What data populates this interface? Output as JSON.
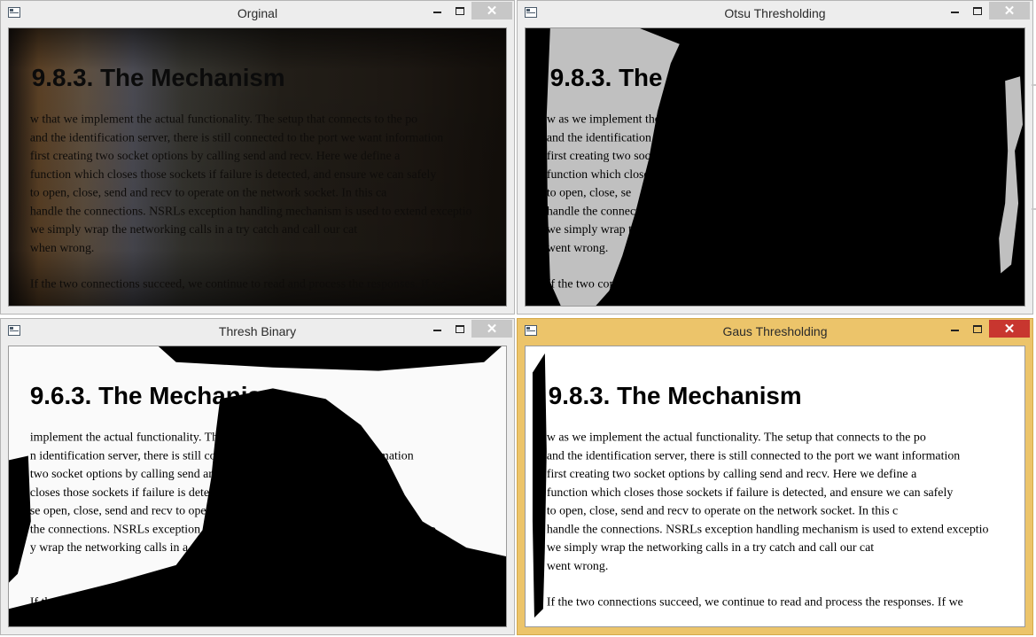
{
  "windows": [
    {
      "title": "Orginal",
      "text": {
        "heading": "9.8.3. The Mechanism",
        "lines": [
          "w that we implement the actual functionality. The setup that connects to the po",
          "and the identification server, there is still connected to the port we want information",
          "first creating two socket options by calling send and recv. Here we define a",
          "function which closes those sockets if failure is detected, and ensure we can safely",
          "to open, close, send and recv to operate on the network socket. In this ca",
          "handle the connections. NSRLs exception handling mechanism is used to extend exceptio",
          "we simply wrap the networking calls in a try catch and call our cat",
          "when wrong.",
          "If the two connections succeed, we continue to read and process the responses. If we"
        ]
      }
    },
    {
      "title": "Otsu Thresholding",
      "text": {
        "heading": "9.8.3. The Mechanism",
        "lines": [
          "w as we implement the actual",
          "and the identification server",
          "first creating two socket",
          "function which closes",
          "to open, close, se",
          "handle the connection",
          "we simply wrap the",
          "went wrong.",
          "If the two connec"
        ]
      }
    },
    {
      "title": "Thresh Binary",
      "text": {
        "heading": "9.6.3. The Mechanism",
        "lines": [
          "implement the actual functionality. The setup that connects to the po",
          "n identification server, there is still connected to the port we want information",
          "two socket options by calling send and recv. Here we define a",
          "closes those sockets if failure is detected and ensure we can safely",
          "se open, close, send and recv to operate on the network socket. In this c",
          "the connections. NSRLs exception handling mechanism is used to extend exceptio",
          "y wrap the networking calls in a try catch and call our ca",
          "",
          "If the two connections succeed"
        ]
      }
    },
    {
      "title": "Gaus Thresholding",
      "text": {
        "heading": "9.8.3. The Mechanism",
        "lines": [
          "w as we implement the actual functionality. The setup that connects to the po",
          "and the identification server, there is still connected to the port we want information",
          "first creating two socket options by calling send and recv. Here we define a",
          "function which closes those sockets if failure is detected, and ensure we can safely",
          "to open, close, send and recv to operate on the network socket. In this c",
          "handle the connections. NSRLs exception handling mechanism is used to extend exceptio",
          "we simply wrap the networking calls in a try catch and call our cat",
          "went wrong.",
          "If the two connections succeed, we continue to read and process the responses. If we"
        ]
      }
    }
  ],
  "controls": {
    "minimize": "—",
    "maximize": "□",
    "close": "✕"
  },
  "colors": {
    "active_frame": "#ecc46a",
    "inactive_frame": "#ededed",
    "close_active": "#c8362f",
    "close_inactive": "#c7c7c7",
    "otsu_page": "#c0c0c0"
  }
}
